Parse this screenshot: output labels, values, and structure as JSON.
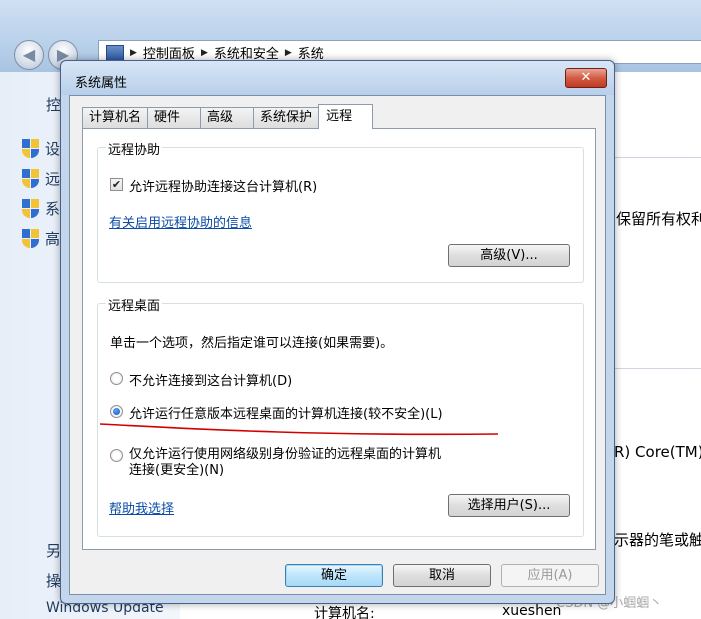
{
  "background": {
    "breadcrumbs": [
      "控制面板",
      "系统和安全",
      "系统"
    ],
    "sidebar_title": "控",
    "sidebar_links": [
      "设",
      "远",
      "系",
      "高"
    ],
    "see_also_label": "另",
    "actions_label": "操",
    "windows_update": "Windows Update",
    "right_texts": {
      "copyright": "保留所有权利",
      "cpu": "R) Core(TM)",
      "pen": "示器的笔或触"
    },
    "footer_label": "计算机名:",
    "footer_value": "xueshen",
    "watermark": "CSDN @小蝈蝈丶"
  },
  "dialog": {
    "title": "系统属性",
    "close_label": "✕",
    "tabs": [
      "计算机名",
      "硬件",
      "高级",
      "系统保护",
      "远程"
    ],
    "active_tab": "远程",
    "remote_assistance": {
      "group_title": "远程协助",
      "checkbox_label": "允许远程协助连接这台计算机(R)",
      "checked": true,
      "info_link": "有关启用远程协助的信息",
      "advanced_button": "高级(V)..."
    },
    "remote_desktop": {
      "group_title": "远程桌面",
      "instruction": "单击一个选项，然后指定谁可以连接(如果需要)。",
      "options": [
        {
          "label": "不允许连接到这台计算机(D)",
          "selected": false
        },
        {
          "label": "允许运行任意版本远程桌面的计算机连接(较不安全)(L)",
          "selected": true
        },
        {
          "label": "仅允许运行使用网络级别身份验证的远程桌面的计算机连接(更安全)(N)",
          "label_line1": "仅允许运行使用网络级别身份验证的远程桌面的计算机",
          "label_line2": "连接(更安全)(N)",
          "selected": false
        }
      ],
      "help_link": "帮助我选择",
      "select_users_button": "选择用户(S)..."
    },
    "buttons": {
      "ok": "确定",
      "cancel": "取消",
      "apply": "应用(A)"
    },
    "annotation_color": "#d40000"
  }
}
